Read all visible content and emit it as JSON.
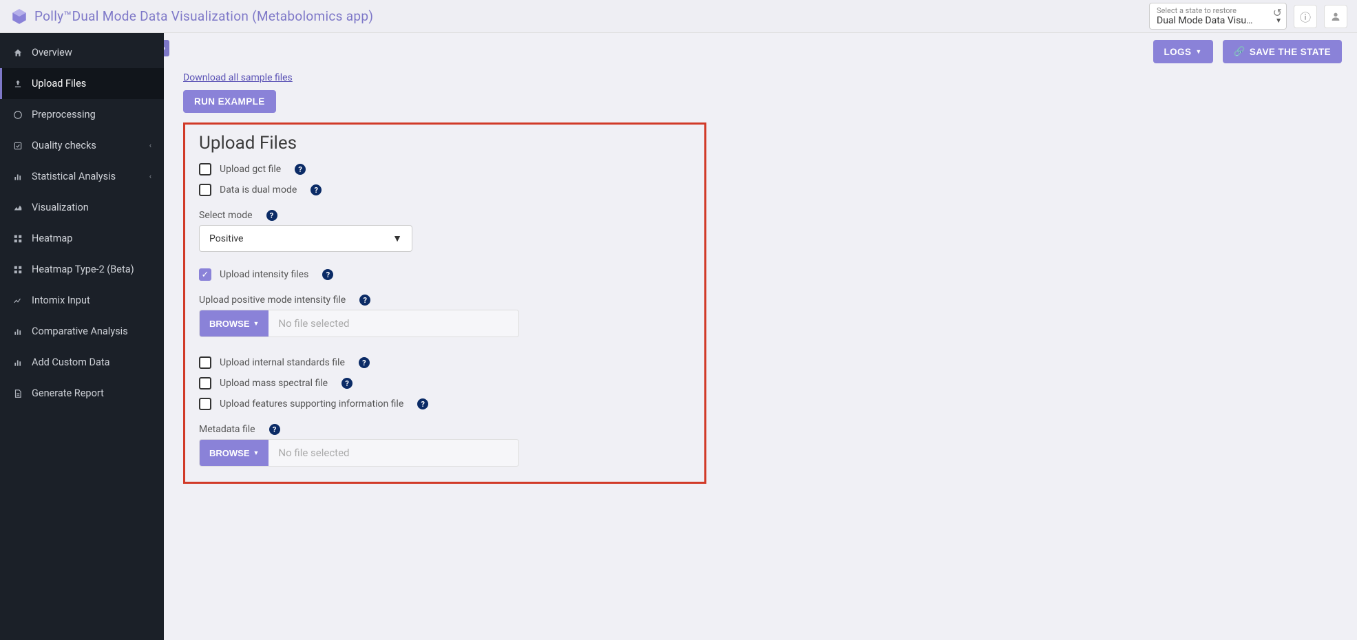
{
  "header": {
    "app_name": "Polly™",
    "title": "Dual Mode Data Visualization (Metabolomics app)",
    "state_restore_label": "Select a state to restore",
    "state_restore_value": "Dual Mode Data Visu…"
  },
  "sidebar": {
    "items": [
      {
        "label": "Overview",
        "icon": "home"
      },
      {
        "label": "Upload Files",
        "icon": "upload",
        "active": true
      },
      {
        "label": "Preprocessing",
        "icon": "spinner"
      },
      {
        "label": "Quality checks",
        "icon": "check-square",
        "expandable": true
      },
      {
        "label": "Statistical Analysis",
        "icon": "bar-chart",
        "expandable": true
      },
      {
        "label": "Visualization",
        "icon": "area-chart"
      },
      {
        "label": "Heatmap",
        "icon": "grid"
      },
      {
        "label": "Heatmap Type-2 (Beta)",
        "icon": "grid"
      },
      {
        "label": "Intomix Input",
        "icon": "line-chart"
      },
      {
        "label": "Comparative Analysis",
        "icon": "bar-chart"
      },
      {
        "label": "Add Custom Data",
        "icon": "bar-chart"
      },
      {
        "label": "Generate Report",
        "icon": "file"
      }
    ]
  },
  "actions": {
    "logs": "LOGS",
    "save_state": "SAVE THE STATE",
    "download_samples": "Download all sample files",
    "run_example": "RUN EXAMPLE"
  },
  "panel": {
    "title": "Upload Files",
    "upload_gct": "Upload gct file",
    "dual_mode": "Data is dual mode",
    "select_mode_label": "Select mode",
    "select_mode_value": "Positive",
    "upload_intensity": "Upload intensity files",
    "positive_intensity_label": "Upload positive mode intensity file",
    "browse": "BROWSE",
    "no_file": "No file selected",
    "internal_standards": "Upload internal standards file",
    "mass_spectral": "Upload mass spectral file",
    "features_support": "Upload features supporting information file",
    "metadata_label": "Metadata file"
  }
}
